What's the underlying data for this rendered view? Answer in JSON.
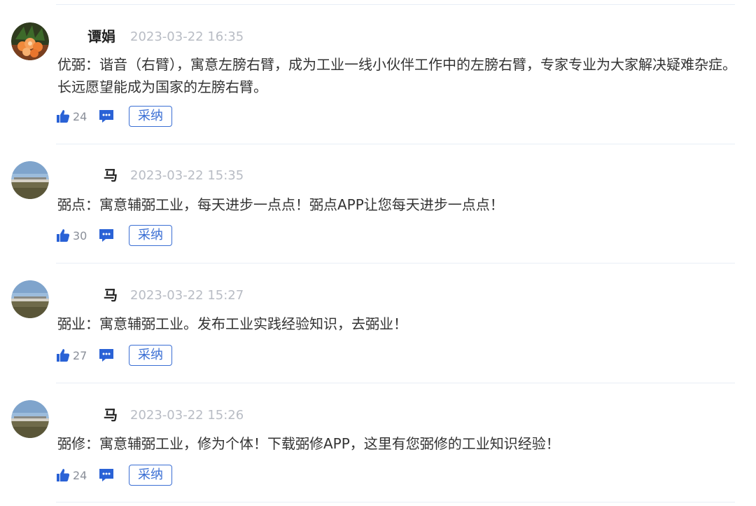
{
  "colors": {
    "accent": "#3b6fd4",
    "icon_blue": "#2a62d6",
    "timestamp": "#b8bcc4",
    "divider": "#e8eef6"
  },
  "comments": [
    {
      "author": "谭娟",
      "time": "2023-03-22 16:35",
      "text": "优弼：谐音（右臂），寓意左膀右臂，成为工业一线小伙伴工作中的左膀右臂，专家专业为大家解决疑难杂症。长远愿望能成为国家的左膀右臂。",
      "likes": "24",
      "adopt_label": "采纳",
      "avatar": "flower-avatar"
    },
    {
      "author": "马",
      "time": "2023-03-22 15:35",
      "text": "弼点：寓意辅弼工业，每天进步一点点！弼点APP让您每天进步一点点！",
      "likes": "30",
      "adopt_label": "采纳",
      "avatar": "landscape-avatar"
    },
    {
      "author": "马",
      "time": "2023-03-22 15:27",
      "text": "弼业：寓意辅弼工业。发布工业实践经验知识，去弼业！",
      "likes": "27",
      "adopt_label": "采纳",
      "avatar": "landscape-avatar"
    },
    {
      "author": "马",
      "time": "2023-03-22 15:26",
      "text": "弼修：寓意辅弼工业，修为个体！下载弼修APP，这里有您弼修的工业知识经验！",
      "likes": "24",
      "adopt_label": "采纳",
      "avatar": "landscape-avatar"
    }
  ]
}
